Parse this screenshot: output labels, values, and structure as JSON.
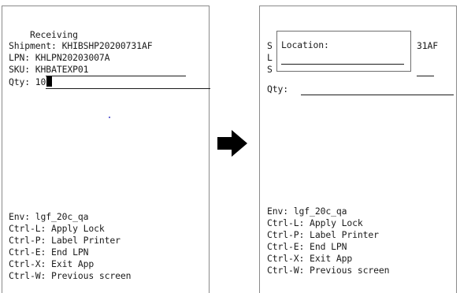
{
  "left": {
    "title": "    Receiving",
    "shipment": "Shipment: KHIBSHP20200731AF",
    "lpn": "LPN: KHLPN20203007A",
    "sku_label": "SKU: ",
    "sku_value": "KHBATEXP01",
    "qty_label": "Qty: ",
    "qty_value": "10",
    "env": "Env: lgf_20c_qa",
    "shortcuts": [
      "Ctrl-L: Apply Lock",
      "Ctrl-P: Label Printer",
      "Ctrl-E: End LPN",
      "Ctrl-X: Exit App",
      "Ctrl-W: Previous screen"
    ]
  },
  "right": {
    "bg_fragments": [
      "S",
      "L",
      "S"
    ],
    "shipment_tail": "31AF",
    "qty_label": "Qty:",
    "popup_label": "Location:",
    "env": "Env: lgf_20c_qa",
    "shortcuts": [
      "Ctrl-L: Apply Lock",
      "Ctrl-P: Label Printer",
      "Ctrl-E: End LPN",
      "Ctrl-X: Exit App",
      "Ctrl-W: Previous screen"
    ]
  },
  "arrow_icon": "right-arrow-icon",
  "colors": {
    "text": "#1b1b1b",
    "border": "#8a8a8a",
    "arrow": "#000000",
    "stray_dot": "#6b6bd6"
  }
}
